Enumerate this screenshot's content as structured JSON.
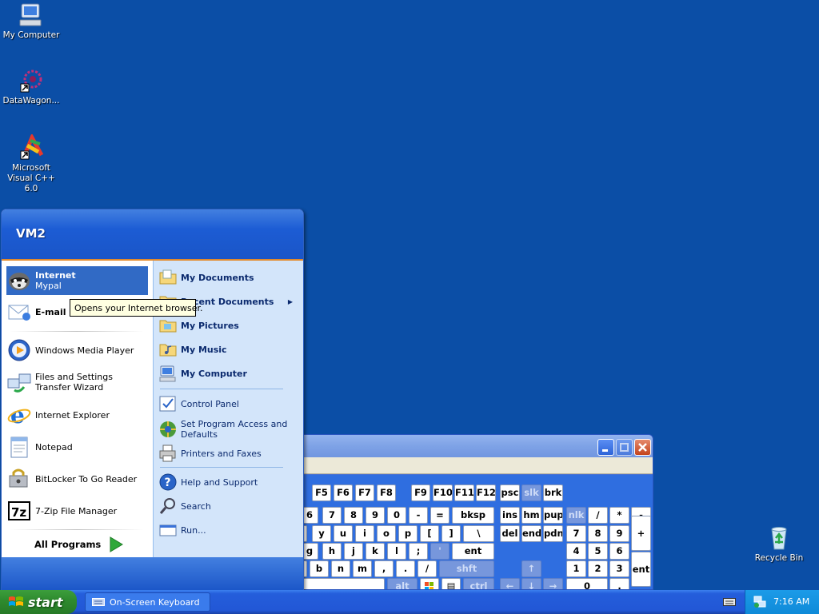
{
  "desktop": {
    "icons": [
      {
        "label": "My Computer",
        "icon": "my-computer-icon"
      },
      {
        "label": "DataWagon...",
        "icon": "datawagon-icon"
      },
      {
        "label": "Microsoft Visual C++ 6.0",
        "icon": "visual-cpp-icon"
      },
      {
        "label": "Recycle Bin",
        "icon": "recycle-bin-icon"
      }
    ]
  },
  "start_menu": {
    "user": "VM2",
    "left": {
      "pinned": [
        {
          "title": "Internet",
          "subtitle": "Mypal",
          "icon": "raccoon-browser-icon"
        },
        {
          "title": "E-mail",
          "icon": "email-icon"
        }
      ],
      "recent": [
        {
          "label": "Windows Media Player",
          "icon": "media-player-icon"
        },
        {
          "label": "Files and Settings Transfer Wizard",
          "icon": "transfer-wizard-icon"
        },
        {
          "label": "Internet Explorer",
          "icon": "internet-explorer-icon"
        },
        {
          "label": "Notepad",
          "icon": "notepad-icon"
        },
        {
          "label": "BitLocker To Go Reader",
          "icon": "bitlocker-icon"
        },
        {
          "label": "7-Zip File Manager",
          "icon": "7zip-icon"
        }
      ],
      "all_programs": "All Programs"
    },
    "right": {
      "places": [
        {
          "label": "My Documents",
          "icon": "folder-documents-icon"
        },
        {
          "label": "Recent Documents",
          "icon": "folder-recent-icon"
        },
        {
          "label": "My Pictures",
          "icon": "folder-pictures-icon"
        },
        {
          "label": "My Music",
          "icon": "folder-music-icon"
        },
        {
          "label": "My Computer",
          "icon": "computer-icon"
        }
      ],
      "settings": [
        {
          "label": "Control Panel",
          "icon": "control-panel-icon"
        },
        {
          "label": "Set Program Access and Defaults",
          "icon": "program-defaults-icon"
        },
        {
          "label": "Printers and Faxes",
          "icon": "printer-icon"
        }
      ],
      "help": [
        {
          "label": "Help and Support",
          "icon": "help-icon"
        },
        {
          "label": "Search",
          "icon": "search-icon"
        },
        {
          "label": "Run...",
          "icon": "run-icon"
        }
      ]
    },
    "tooltip": "Opens your Internet browser."
  },
  "osk": {
    "keys": {
      "row_f": [
        "F5",
        "F6",
        "F7",
        "F8",
        "F9",
        "F10",
        "F11",
        "F12",
        "psc",
        "slk",
        "brk"
      ],
      "row1": [
        "6",
        "7",
        "8",
        "9",
        "0",
        "-",
        "=",
        "bksp",
        "ins",
        "hm",
        "pup",
        "nlk",
        "/",
        "*",
        "-"
      ],
      "row2": [
        "y",
        "u",
        "i",
        "o",
        "p",
        "[",
        "]",
        "\\",
        "del",
        "end",
        "pdn",
        "7",
        "8",
        "9",
        "+"
      ],
      "row3": [
        "g",
        "h",
        "j",
        "k",
        "l",
        ";",
        "'",
        "ent",
        "4",
        "5",
        "6"
      ],
      "row4": [
        "b",
        "n",
        "m",
        ",",
        ".",
        "/",
        "shft",
        "1",
        "2",
        "3",
        "ent"
      ],
      "row5": [
        "alt",
        "ctrl",
        "0",
        "."
      ]
    }
  },
  "taskbar": {
    "start_label": "start",
    "tasks": [
      {
        "label": "On-Screen Keyboard"
      }
    ],
    "clock": "7:16 AM"
  }
}
